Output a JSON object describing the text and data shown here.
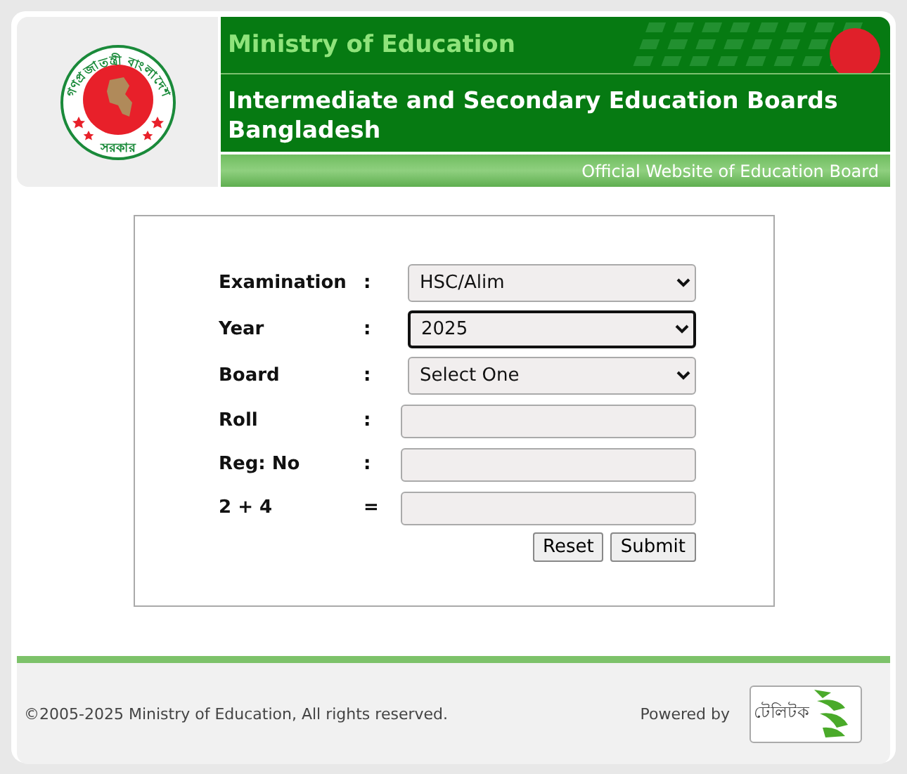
{
  "header": {
    "emblem_text_top": "গণপ্রজাতন্ত্রী বাংলাদেশ",
    "emblem_text_bottom": "সরকার",
    "ministry": "Ministry of Education",
    "title": "Intermediate and Secondary Education Boards Bangladesh",
    "tagline": "Official Website of Education Board"
  },
  "form": {
    "fields": [
      {
        "kind": "select",
        "label": "Examination",
        "separator": ":",
        "value": "HSC/Alim",
        "focused": false
      },
      {
        "kind": "select",
        "label": "Year",
        "separator": ":",
        "value": "2025",
        "focused": true
      },
      {
        "kind": "select",
        "label": "Board",
        "separator": ":",
        "value": "Select One",
        "focused": false
      },
      {
        "kind": "input",
        "label": "Roll",
        "separator": ":"
      },
      {
        "kind": "input",
        "label": "Reg: No",
        "separator": ":"
      },
      {
        "kind": "input",
        "label": "2 + 4",
        "separator": "="
      }
    ],
    "buttons": [
      "Reset",
      "Submit"
    ]
  },
  "footer": {
    "copyright": "©2005-2025 Ministry of Education, All rights reserved.",
    "powered_by": "Powered by",
    "partner_logo": "টেলিটক"
  }
}
